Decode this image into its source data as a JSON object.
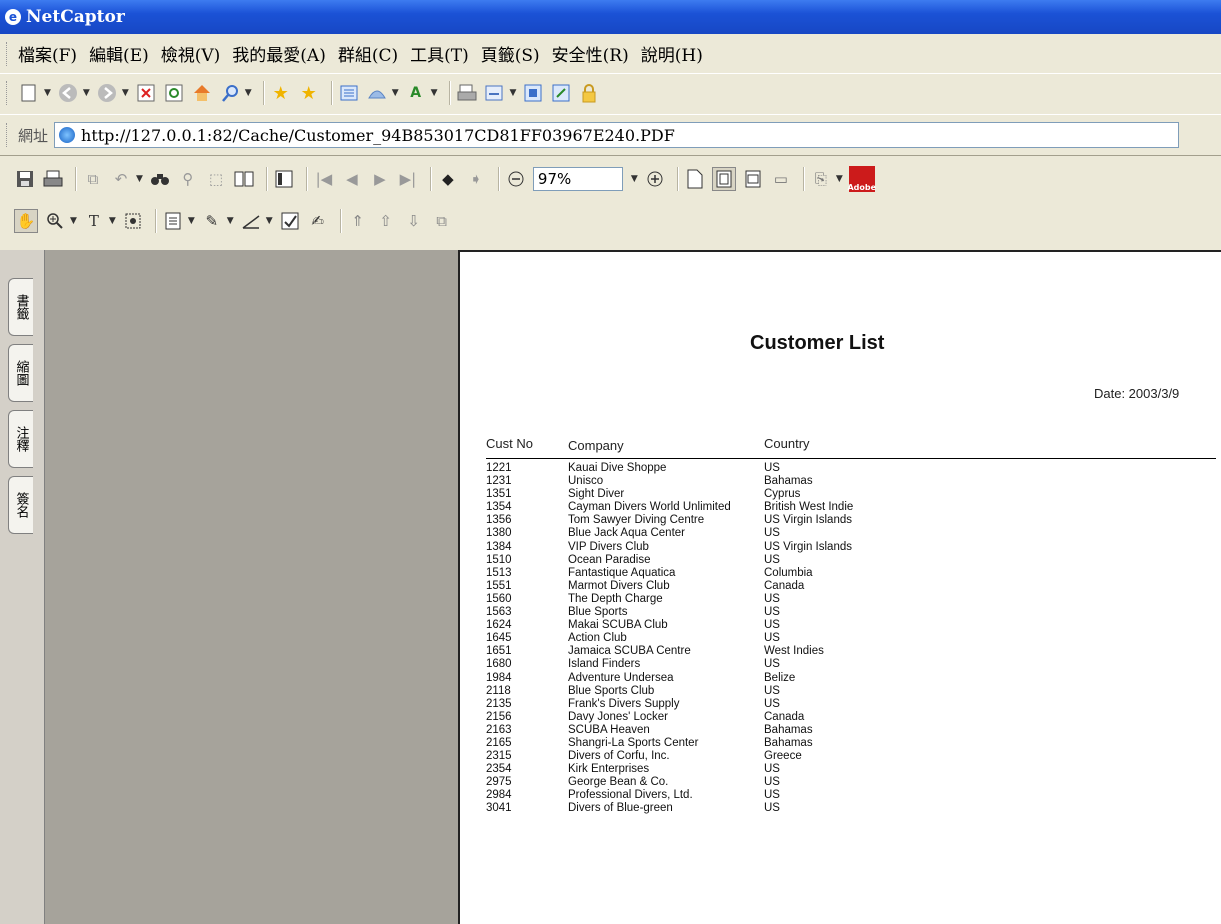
{
  "window": {
    "title": "NetCaptor"
  },
  "menu": [
    "檔案(F)",
    "編輯(E)",
    "檢視(V)",
    "我的最愛(A)",
    "群組(C)",
    "工具(T)",
    "頁籤(S)",
    "安全性(R)",
    "說明(H)"
  ],
  "address": {
    "label": "網址",
    "url": "http://127.0.0.1:82/Cache/Customer_94B853017CD81FF03967E240.PDF"
  },
  "pdf_toolbar": {
    "zoom": "97%"
  },
  "side_tabs": [
    "書籤",
    "縮圖",
    "注釋",
    "簽名"
  ],
  "document": {
    "title": "Customer List",
    "date": "Date:  2003/3/9",
    "columns": [
      "Cust No",
      "Company",
      "Country"
    ],
    "rows": [
      [
        "1221",
        "Kauai Dive Shoppe",
        "US"
      ],
      [
        "1231",
        "Unisco",
        "Bahamas"
      ],
      [
        "1351",
        "Sight Diver",
        "Cyprus"
      ],
      [
        "1354",
        "Cayman Divers World Unlimited",
        "British West Indie"
      ],
      [
        "1356",
        "Tom Sawyer Diving Centre",
        "US Virgin Islands"
      ],
      [
        "1380",
        "Blue Jack Aqua Center",
        "US"
      ],
      [
        "1384",
        "VIP Divers Club",
        "US Virgin Islands"
      ],
      [
        "1510",
        "Ocean Paradise",
        "US"
      ],
      [
        "1513",
        "Fantastique Aquatica",
        "Columbia"
      ],
      [
        "1551",
        "Marmot Divers Club",
        "Canada"
      ],
      [
        "1560",
        "The Depth Charge",
        "US"
      ],
      [
        "1563",
        "Blue Sports",
        "US"
      ],
      [
        "1624",
        "Makai SCUBA Club",
        "US"
      ],
      [
        "1645",
        "Action Club",
        "US"
      ],
      [
        "1651",
        "Jamaica SCUBA Centre",
        "West Indies"
      ],
      [
        "1680",
        "Island Finders",
        "US"
      ],
      [
        "1984",
        "Adventure Undersea",
        "Belize"
      ],
      [
        "2118",
        "Blue Sports Club",
        "US"
      ],
      [
        "2135",
        "Frank's Divers Supply",
        "US"
      ],
      [
        "2156",
        "Davy Jones' Locker",
        "Canada"
      ],
      [
        "2163",
        "SCUBA Heaven",
        "Bahamas"
      ],
      [
        "2165",
        "Shangri-La Sports Center",
        "Bahamas"
      ],
      [
        "2315",
        "Divers of Corfu, Inc.",
        "Greece"
      ],
      [
        "2354",
        "Kirk Enterprises",
        "US"
      ],
      [
        "2975",
        "George Bean & Co.",
        "US"
      ],
      [
        "2984",
        "Professional Divers, Ltd.",
        "US"
      ],
      [
        "3041",
        "Divers of Blue-green",
        "US"
      ]
    ]
  }
}
